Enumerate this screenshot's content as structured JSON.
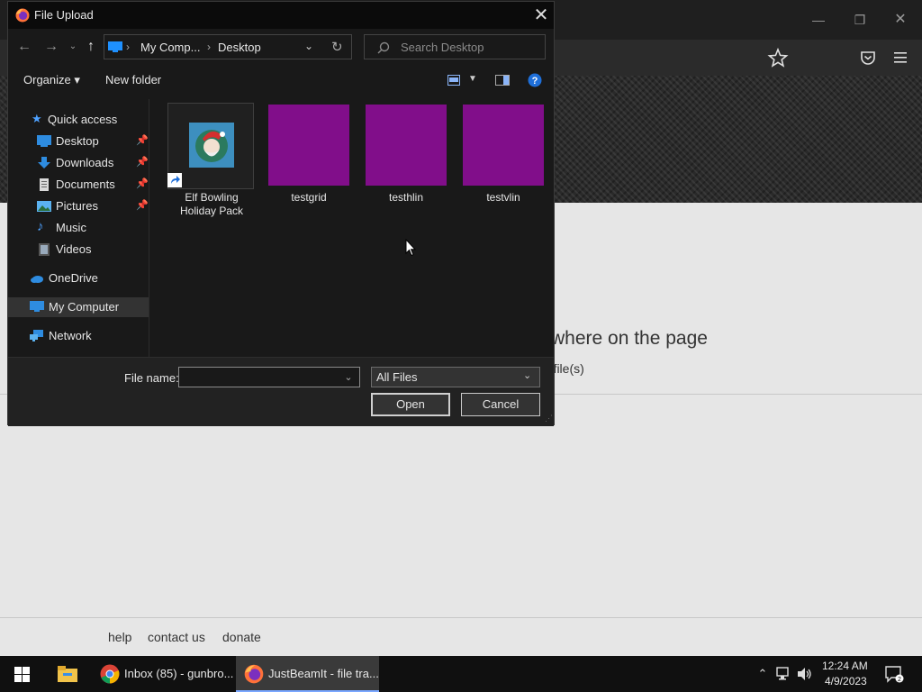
{
  "browser": {
    "drop_title": "where on the page",
    "drop_sub": "r file(s)",
    "footer_links": [
      "help",
      "contact us",
      "donate"
    ]
  },
  "dialog": {
    "title": "File Upload",
    "breadcrumb": [
      "My Comp...",
      "Desktop"
    ],
    "search_placeholder": "Search Desktop",
    "toolbar": {
      "organize": "Organize ▾",
      "new_folder": "New folder"
    },
    "sidebar": {
      "quick_access": "Quick access",
      "items": [
        {
          "label": "Desktop",
          "pinned": true
        },
        {
          "label": "Downloads",
          "pinned": true
        },
        {
          "label": "Documents",
          "pinned": true
        },
        {
          "label": "Pictures",
          "pinned": true
        },
        {
          "label": "Music",
          "pinned": false
        },
        {
          "label": "Videos",
          "pinned": false
        }
      ],
      "onedrive": "OneDrive",
      "my_computer": "My Computer",
      "network": "Network"
    },
    "files": [
      {
        "label": "Elf Bowling Holiday Pack",
        "kind": "shortcut"
      },
      {
        "label": "testgrid",
        "kind": "image",
        "color": "#810e8a"
      },
      {
        "label": "testhlin",
        "kind": "image",
        "color": "#810e8a"
      },
      {
        "label": "testvlin",
        "kind": "image",
        "color": "#810e8a"
      }
    ],
    "filename_label": "File name:",
    "filename_value": "",
    "filetype_value": "All Files",
    "open_label": "Open",
    "cancel_label": "Cancel"
  },
  "taskbar": {
    "items": [
      {
        "label": "Inbox (85) - gunbro..."
      },
      {
        "label": "JustBeamIt - file tra..."
      }
    ],
    "time": "12:24 AM",
    "date": "4/9/2023"
  },
  "colors": {
    "accent": "#7aa7ff",
    "thumb": "#810e8a",
    "dialog_bg": "#191919"
  }
}
